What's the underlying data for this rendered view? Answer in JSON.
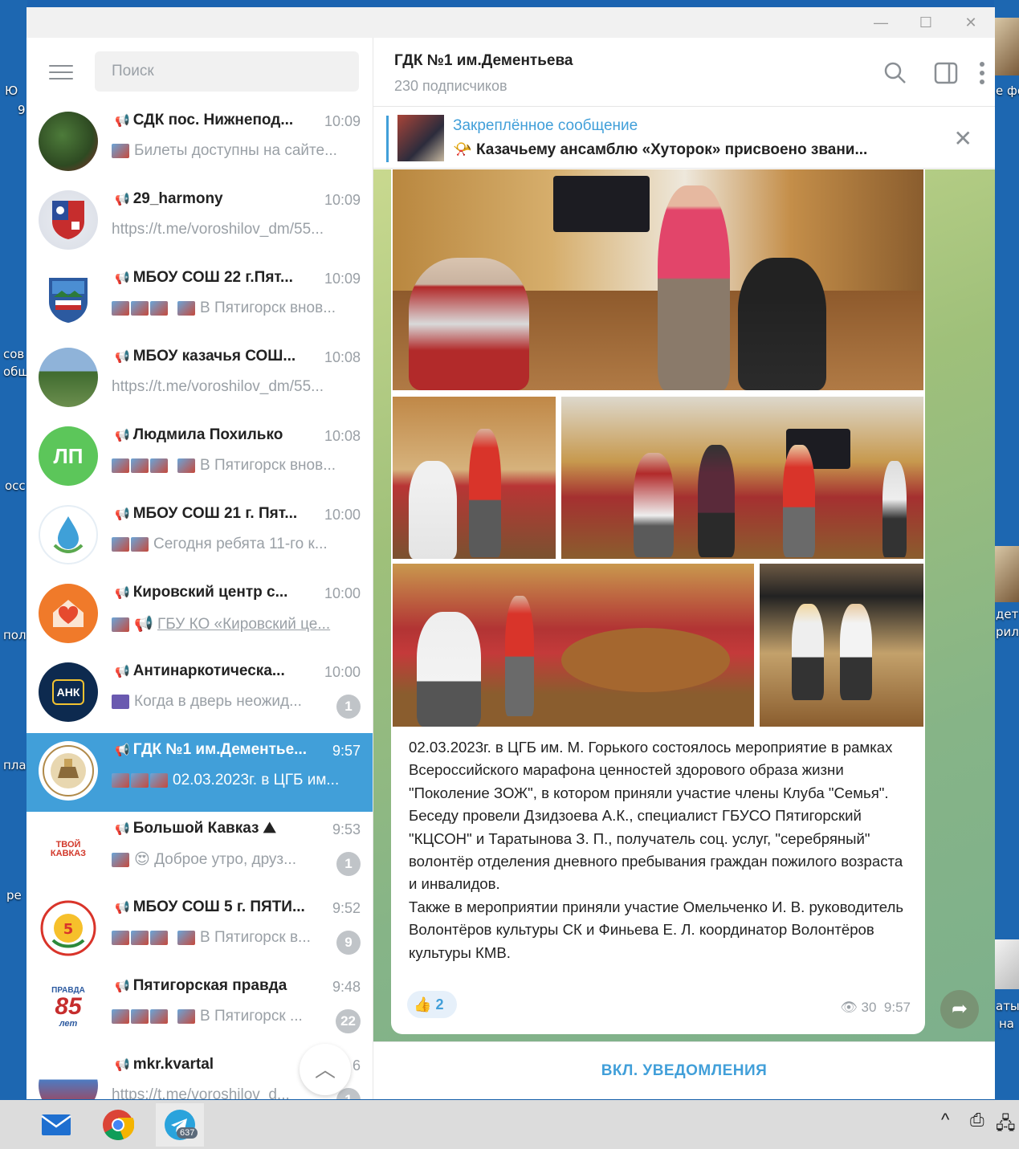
{
  "desktop": {
    "left_labels": [
      "Ю",
      "9",
      "сов",
      "общ",
      "осс",
      "пол",
      "пла",
      "ре"
    ],
    "right_labels": [
      "е фо",
      "дет",
      "рил",
      "аты",
      "на"
    ]
  },
  "window": {
    "controls": {
      "minimize": "—",
      "maximize": "☐",
      "close": "✕"
    }
  },
  "sidebar": {
    "search_placeholder": "Поиск",
    "chats": [
      {
        "title": "СДК пос. Нижнепод...",
        "time": "10:09",
        "preview": "Билеты доступны на сайте...",
        "badge": "",
        "avatar": "photo",
        "thumbs": 1
      },
      {
        "title": "29_harmony",
        "time": "10:09",
        "preview": "https://t.me/voroshilov_dm/55...",
        "badge": "",
        "avatar": "emblem",
        "thumbs": 0
      },
      {
        "title": "МБОУ СОШ 22 г.Пят...",
        "time": "10:09",
        "preview": "В Пятигорск внов...",
        "badge": "",
        "avatar": "emblem",
        "thumbs": 4
      },
      {
        "title": "МБОУ казачья СОШ...",
        "time": "10:08",
        "preview": "https://t.me/voroshilov_dm/55...",
        "badge": "",
        "avatar": "photo",
        "thumbs": 0
      },
      {
        "title": "Людмила Похилько",
        "time": "10:08",
        "preview": "В Пятигорск внов...",
        "badge": "",
        "avatar": "ЛП",
        "thumbs": 4
      },
      {
        "title": "МБОУ СОШ 21 г. Пят...",
        "time": "10:00",
        "preview": "Сегодня ребята 11-го к...",
        "badge": "",
        "avatar": "emblem",
        "thumbs": 2
      },
      {
        "title": "Кировский центр с...",
        "time": "10:00",
        "preview": "ГБУ КО «Кировский це...",
        "badge": "",
        "avatar": "emblem",
        "thumbs": 2
      },
      {
        "title": "Антинаркотическа...",
        "time": "10:00",
        "preview": "Когда в дверь неожид...",
        "badge": "1",
        "avatar": "АНК",
        "thumbs": 1
      },
      {
        "title": "ГДК №1 им.Дементье...",
        "time": "9:57",
        "preview": "02.03.2023г. в ЦГБ им...",
        "badge": "",
        "avatar": "emblem",
        "thumbs": 3
      },
      {
        "title": "Большой Кавказ",
        "time": "9:53",
        "preview": "Доброе утро, друз...",
        "badge": "1",
        "avatar": "emblem",
        "thumbs": 2
      },
      {
        "title": "МБОУ СОШ 5 г. ПЯТИ...",
        "time": "9:52",
        "preview": "В Пятигорск в...",
        "badge": "9",
        "avatar": "emblem",
        "thumbs": 4
      },
      {
        "title": "Пятигорская правда",
        "time": "9:48",
        "preview": "В Пятигорск ...",
        "badge": "22",
        "avatar": "emblem",
        "thumbs": 4
      },
      {
        "title": "mkr.kvartal",
        "time": "6",
        "preview": "https://t.me/voroshilov_d...",
        "badge": "1",
        "avatar": "emblem",
        "thumbs": 0
      }
    ],
    "avatar_texts": {
      "lp": "ЛП",
      "ank": "АНК",
      "tvoy": "ТВОЙ КАВКАЗ",
      "pravda_big": "85",
      "pravda_small": "ПРАВДА",
      "pravda_let": "лет"
    }
  },
  "channel": {
    "title": "ГДК №1 им.Дементьева",
    "subscribers": "230 подписчиков",
    "pinned_label": "Закреплённое сообщение",
    "pinned_text": "Казачьему ансамблю «Хуторок» присвоено звани...",
    "message_text": "02.03.2023г. в ЦГБ им. М. Горького состоялось мероприятие в рамках Всероссийского марафона ценностей здорового образа жизни \"Поколение ЗОЖ\", в котором приняли участие члены Клуба \"Семья\". Беседу провели Дзидзоева А.К., специалист ГБУСО Пятигорский \"КЦСОН\" и Таратынова З. П., получатель соц. услуг, \"серебряный\" волонтёр отделения дневного пребывания граждан пожилого возраста и инвалидов.\nТакже в мероприятии приняли участие Омельченко И. В. руководитель Волонтёров культуры СК и Финьева Е. Л. координатор Волонтёров культуры КМВ.",
    "reaction_emoji": "👍",
    "reaction_count": "2",
    "views": "30",
    "time": "9:57",
    "notify_button": "ВКЛ. УВЕДОМЛЕНИЯ"
  },
  "taskbar": {
    "telegram_badge": "637",
    "tray": [
      "^",
      "⎙",
      "🖧"
    ]
  },
  "colors": {
    "accent": "#419fd9",
    "active_chat": "#419fd9",
    "taskbar": "#dcdcdc"
  }
}
